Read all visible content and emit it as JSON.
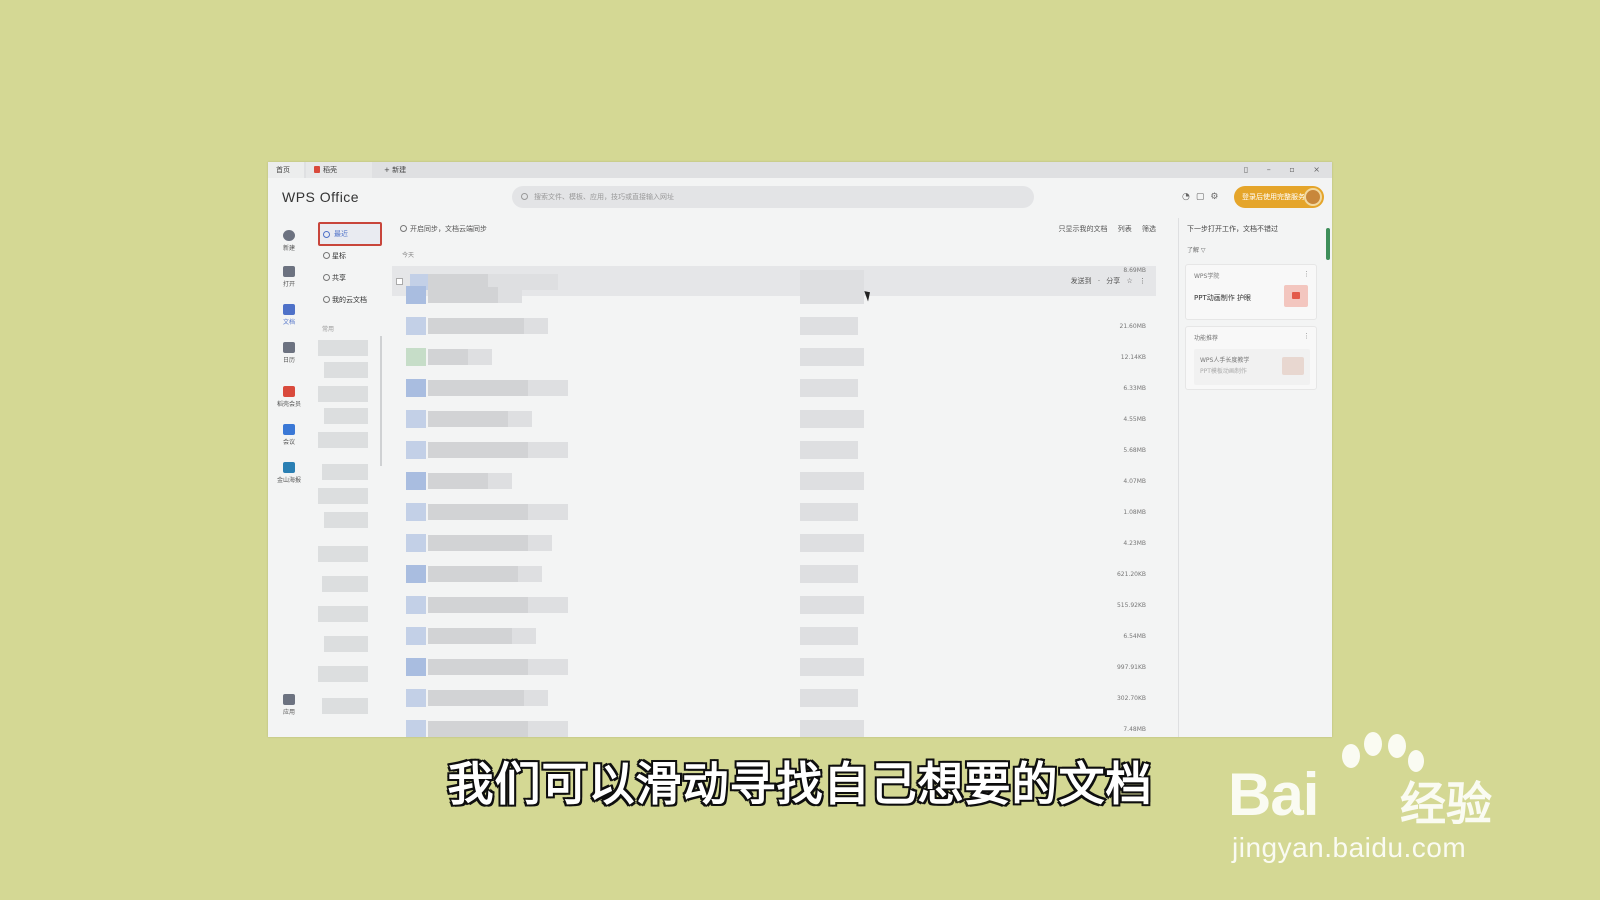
{
  "window": {
    "tabs": [
      "首页",
      "稻壳",
      "+ 新建"
    ],
    "controls": "▯ – ▫ ×"
  },
  "header": {
    "logo": "WPS Office",
    "search_placeholder": "搜索文件、模板、应用，技巧或直接输入网址",
    "icons": [
      "headset-icon",
      "cart-icon",
      "gear-icon"
    ],
    "vip_label": "登录后使用完整服务"
  },
  "rail": [
    {
      "label": "新建",
      "icon": "plus-circle-icon"
    },
    {
      "label": "打开",
      "icon": "folder-icon"
    },
    {
      "label": "文档",
      "icon": "document-icon",
      "active": true
    },
    {
      "label": "日历",
      "icon": "calendar-icon"
    },
    {
      "label": "稻壳会员",
      "icon": "docer-icon"
    },
    {
      "label": "会议",
      "icon": "meeting-icon"
    },
    {
      "label": "金山海报",
      "icon": "poster-icon"
    },
    {
      "label": "应用",
      "icon": "apps-grid-icon"
    }
  ],
  "nav": {
    "items": [
      {
        "label": "最近",
        "selected": true
      },
      {
        "label": "星标"
      },
      {
        "label": "共享"
      },
      {
        "label": "我的云文档"
      }
    ],
    "section": "常用"
  },
  "main": {
    "top_hint": "开启同步，文档云端同步",
    "tools": [
      "只显示我的文档",
      "列表",
      "筛选"
    ],
    "group": "今天",
    "row_actions": "发送到 · 分享 ☆ ⋮",
    "sizes": [
      "8.69MB",
      "21.60MB",
      "12.14KB",
      "6.33MB",
      "4.55MB",
      "5.68MB",
      "4.07MB",
      "1.08MB",
      "4.23MB",
      "621.20KB",
      "515.92KB",
      "6.54MB",
      "997.91KB",
      "302.70KB",
      "7.48MB"
    ]
  },
  "rpanel": {
    "title": "下一步打开工作，文档不错过",
    "subtitle": "了解  ▽",
    "card1": {
      "title": "WPS学院",
      "body": "PPT动画制作 护眼"
    },
    "card2": {
      "title": "功能推荐",
      "line1": "WPS人手长度教学",
      "line2": "PPT模板动画制作"
    }
  },
  "caption": "我们可以滑动寻找自己想要的文档",
  "watermark": {
    "brand": "Bai",
    "brand2": "经验",
    "url": "jingyan.baidu.com"
  }
}
